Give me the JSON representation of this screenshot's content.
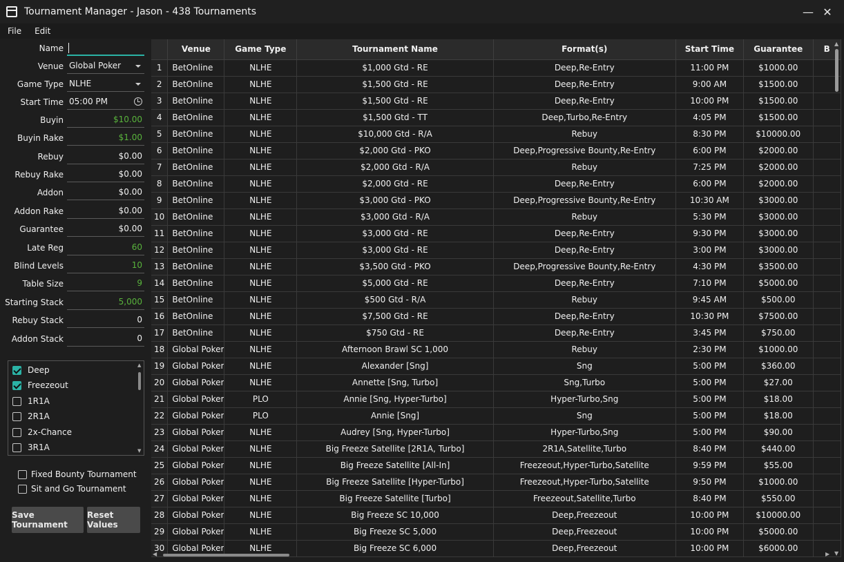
{
  "window": {
    "title": "Tournament Manager - Jason - 438 Tournaments",
    "minimize_glyph": "—",
    "close_glyph": "✕"
  },
  "menu": {
    "file": "File",
    "edit": "Edit"
  },
  "form": {
    "name": {
      "label": "Name",
      "value": ""
    },
    "venue": {
      "label": "Venue",
      "value": "Global Poker"
    },
    "game_type": {
      "label": "Game Type",
      "value": "NLHE"
    },
    "start_time": {
      "label": "Start Time",
      "value": "05:00 PM"
    },
    "buyin": {
      "label": "Buyin",
      "value": "$10.00"
    },
    "buyin_rake": {
      "label": "Buyin Rake",
      "value": "$1.00"
    },
    "rebuy": {
      "label": "Rebuy",
      "value": "$0.00"
    },
    "rebuy_rake": {
      "label": "Rebuy Rake",
      "value": "$0.00"
    },
    "addon": {
      "label": "Addon",
      "value": "$0.00"
    },
    "addon_rake": {
      "label": "Addon Rake",
      "value": "$0.00"
    },
    "guarantee": {
      "label": "Guarantee",
      "value": "$0.00"
    },
    "late_reg": {
      "label": "Late Reg",
      "value": "60"
    },
    "blind_levels": {
      "label": "Blind Levels",
      "value": "10"
    },
    "table_size": {
      "label": "Table Size",
      "value": "9"
    },
    "starting_stack": {
      "label": "Starting Stack",
      "value": "5,000"
    },
    "rebuy_stack": {
      "label": "Rebuy Stack",
      "value": "0"
    },
    "addon_stack": {
      "label": "Addon Stack",
      "value": "0"
    }
  },
  "formats": [
    {
      "label": "Deep",
      "checked": true
    },
    {
      "label": "Freezeout",
      "checked": true
    },
    {
      "label": "1R1A",
      "checked": false
    },
    {
      "label": "2R1A",
      "checked": false
    },
    {
      "label": "2x-Chance",
      "checked": false
    },
    {
      "label": "3R1A",
      "checked": false
    }
  ],
  "options": {
    "fixed_bounty": "Fixed Bounty Tournament",
    "sit_and_go": "Sit and Go Tournament"
  },
  "buttons": {
    "save": "Save Tournament",
    "reset": "Reset Values"
  },
  "table": {
    "columns": [
      "Venue",
      "Game Type",
      "Tournament Name",
      "Format(s)",
      "Start Time",
      "Guarantee",
      "B"
    ],
    "rows": [
      [
        "1",
        "BetOnline",
        "NLHE",
        "$1,000 Gtd - RE",
        "Deep,Re-Entry",
        "11:00 PM",
        "$1000.00"
      ],
      [
        "2",
        "BetOnline",
        "NLHE",
        "$1,500 Gtd - RE",
        "Deep,Re-Entry",
        "9:00 AM",
        "$1500.00"
      ],
      [
        "3",
        "BetOnline",
        "NLHE",
        "$1,500 Gtd - RE",
        "Deep,Re-Entry",
        "10:00 PM",
        "$1500.00"
      ],
      [
        "4",
        "BetOnline",
        "NLHE",
        "$1,500 Gtd - TT",
        "Deep,Turbo,Re-Entry",
        "4:05 PM",
        "$1500.00"
      ],
      [
        "5",
        "BetOnline",
        "NLHE",
        "$10,000 Gtd - R/A",
        "Rebuy",
        "8:30 PM",
        "$10000.00"
      ],
      [
        "6",
        "BetOnline",
        "NLHE",
        "$2,000 Gtd - PKO",
        "Deep,Progressive Bounty,Re-Entry",
        "6:00 PM",
        "$2000.00"
      ],
      [
        "7",
        "BetOnline",
        "NLHE",
        "$2,000 Gtd - R/A",
        "Rebuy",
        "7:25 PM",
        "$2000.00"
      ],
      [
        "8",
        "BetOnline",
        "NLHE",
        "$2,000 Gtd - RE",
        "Deep,Re-Entry",
        "6:00 PM",
        "$2000.00"
      ],
      [
        "9",
        "BetOnline",
        "NLHE",
        "$3,000 Gtd - PKO",
        "Deep,Progressive Bounty,Re-Entry",
        "10:30 AM",
        "$3000.00"
      ],
      [
        "10",
        "BetOnline",
        "NLHE",
        "$3,000 Gtd - R/A",
        "Rebuy",
        "5:30 PM",
        "$3000.00"
      ],
      [
        "11",
        "BetOnline",
        "NLHE",
        "$3,000 Gtd - RE",
        "Deep,Re-Entry",
        "9:30 PM",
        "$3000.00"
      ],
      [
        "12",
        "BetOnline",
        "NLHE",
        "$3,000 Gtd - RE",
        "Deep,Re-Entry",
        "3:00 PM",
        "$3000.00"
      ],
      [
        "13",
        "BetOnline",
        "NLHE",
        "$3,500 Gtd - PKO",
        "Deep,Progressive Bounty,Re-Entry",
        "4:30 PM",
        "$3500.00"
      ],
      [
        "14",
        "BetOnline",
        "NLHE",
        "$5,000 Gtd - RE",
        "Deep,Re-Entry",
        "7:10 PM",
        "$5000.00"
      ],
      [
        "15",
        "BetOnline",
        "NLHE",
        "$500 Gtd - R/A",
        "Rebuy",
        "9:45 AM",
        "$500.00"
      ],
      [
        "16",
        "BetOnline",
        "NLHE",
        "$7,500 Gtd - RE",
        "Deep,Re-Entry",
        "10:30 PM",
        "$7500.00"
      ],
      [
        "17",
        "BetOnline",
        "NLHE",
        "$750 Gtd - RE",
        "Deep,Re-Entry",
        "3:45 PM",
        "$750.00"
      ],
      [
        "18",
        "Global Poker",
        "NLHE",
        "Afternoon Brawl SC 1,000",
        "Rebuy",
        "2:30 PM",
        "$1000.00"
      ],
      [
        "19",
        "Global Poker",
        "NLHE",
        "Alexander [Sng]",
        "Sng",
        "5:00 PM",
        "$360.00"
      ],
      [
        "20",
        "Global Poker",
        "NLHE",
        "Annette [Sng, Turbo]",
        "Sng,Turbo",
        "5:00 PM",
        "$27.00"
      ],
      [
        "21",
        "Global Poker",
        "PLO",
        "Annie [Sng, Hyper-Turbo]",
        "Hyper-Turbo,Sng",
        "5:00 PM",
        "$18.00"
      ],
      [
        "22",
        "Global Poker",
        "PLO",
        "Annie [Sng]",
        "Sng",
        "5:00 PM",
        "$18.00"
      ],
      [
        "23",
        "Global Poker",
        "NLHE",
        "Audrey [Sng, Hyper-Turbo]",
        "Hyper-Turbo,Sng",
        "5:00 PM",
        "$90.00"
      ],
      [
        "24",
        "Global Poker",
        "NLHE",
        "Big Freeze Satellite [2R1A, Turbo]",
        "2R1A,Satellite,Turbo",
        "8:40 PM",
        "$440.00"
      ],
      [
        "25",
        "Global Poker",
        "NLHE",
        "Big Freeze Satellite [All-In]",
        "Freezeout,Hyper-Turbo,Satellite",
        "9:59 PM",
        "$55.00"
      ],
      [
        "26",
        "Global Poker",
        "NLHE",
        "Big Freeze Satellite [Hyper-Turbo]",
        "Freezeout,Hyper-Turbo,Satellite",
        "9:50 PM",
        "$1000.00"
      ],
      [
        "27",
        "Global Poker",
        "NLHE",
        "Big Freeze Satellite [Turbo]",
        "Freezeout,Satellite,Turbo",
        "8:40 PM",
        "$550.00"
      ],
      [
        "28",
        "Global Poker",
        "NLHE",
        "Big Freeze SC 10,000",
        "Deep,Freezeout",
        "10:00 PM",
        "$10000.00"
      ],
      [
        "29",
        "Global Poker",
        "NLHE",
        "Big Freeze SC 5,000",
        "Deep,Freezeout",
        "10:00 PM",
        "$5000.00"
      ],
      [
        "30",
        "Global Poker",
        "NLHE",
        "Big Freeze SC 6,000",
        "Deep,Freezeout",
        "10:00 PM",
        "$6000.00"
      ]
    ]
  },
  "scroll_glyphs": {
    "up": "▲",
    "down": "▼",
    "left": "◀",
    "right": "▶"
  }
}
